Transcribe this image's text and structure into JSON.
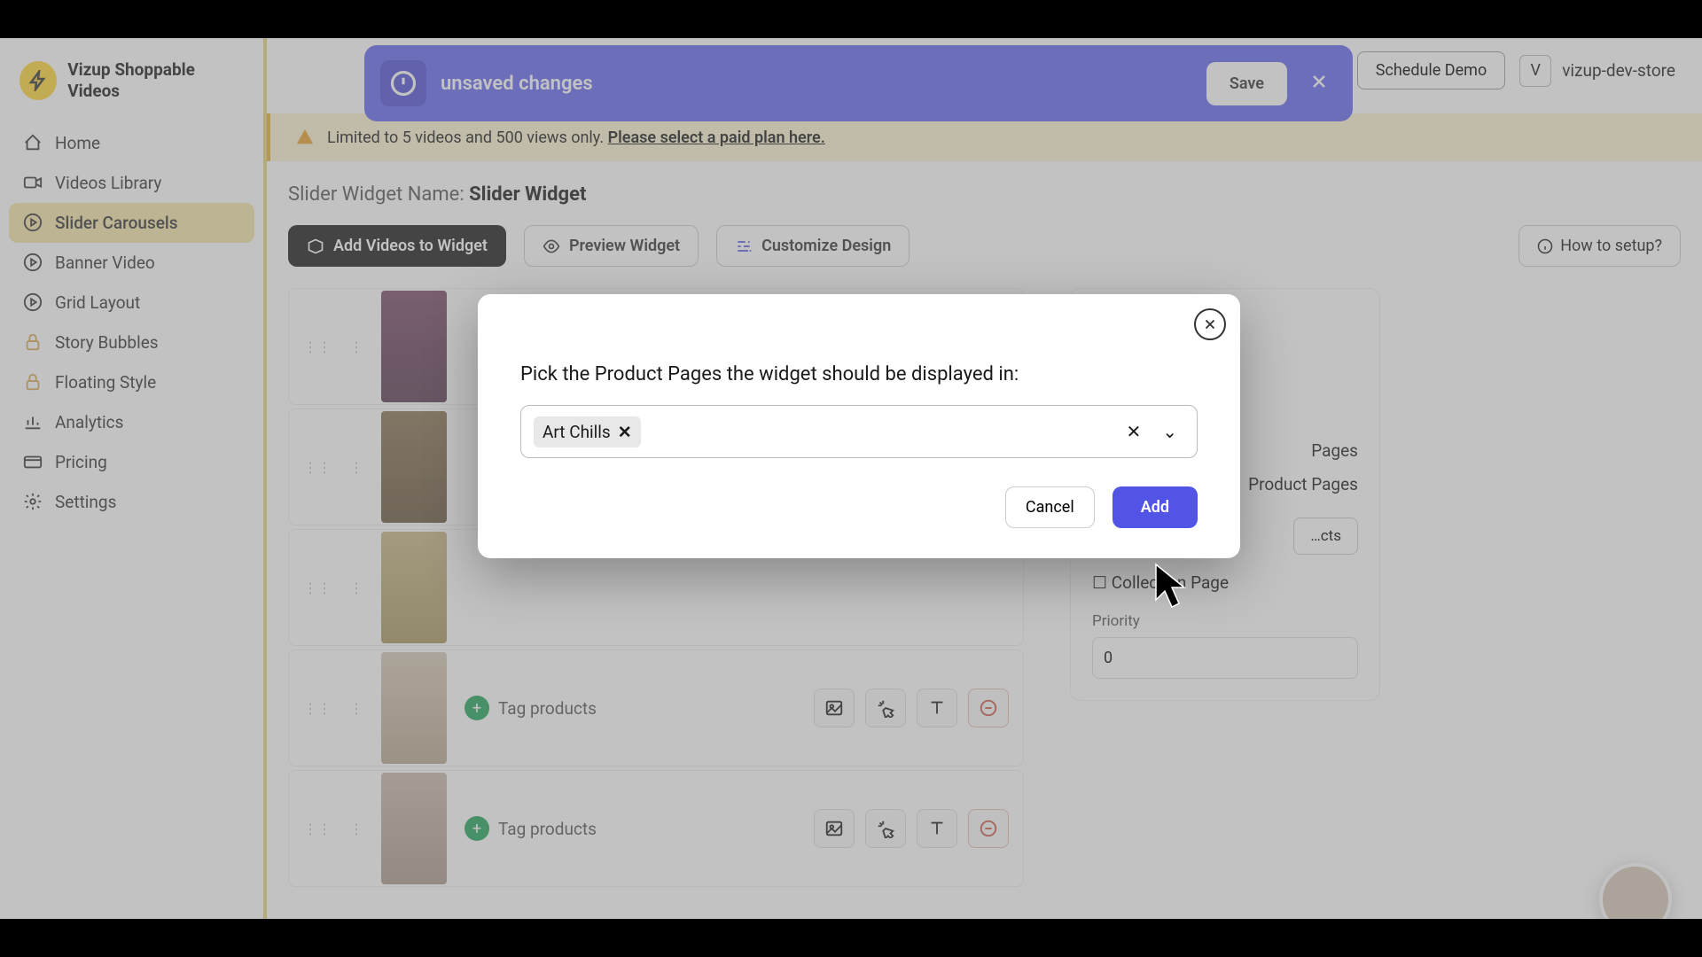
{
  "brand": {
    "name": "Vizup Shoppable Videos"
  },
  "nav": {
    "home": "Home",
    "videos": "Videos Library",
    "slider": "Slider Carousels",
    "banner": "Banner Video",
    "grid": "Grid Layout",
    "story": "Story Bubbles",
    "floating": "Floating Style",
    "analytics": "Analytics",
    "pricing": "Pricing",
    "settings": "Settings"
  },
  "header": {
    "schedule": "Schedule Demo",
    "store_initial": "V",
    "store_name": "vizup-dev-store"
  },
  "unsaved": {
    "text": "unsaved changes",
    "save": "Save"
  },
  "plan": {
    "text": "Limited to 5 videos and 500 views only. ",
    "link": "Please select a paid plan here."
  },
  "widget": {
    "label": "Slider Widget Name: ",
    "value": "Slider Widget"
  },
  "toolbar": {
    "add": "Add Videos to Widget",
    "preview": "Preview Widget",
    "customize": "Customize Design",
    "setup": "How to setup?"
  },
  "row": {
    "tag": "Tag products"
  },
  "panel": {
    "opt_pages": "Pages",
    "opt_product": "Product Pages",
    "select_products": "…cts",
    "collection": "Collection Page",
    "priority_label": "Priority",
    "priority_value": "0"
  },
  "modal": {
    "title": "Pick the Product Pages the widget should be displayed in:",
    "chip": "Art Chills",
    "cancel": "Cancel",
    "add": "Add"
  }
}
